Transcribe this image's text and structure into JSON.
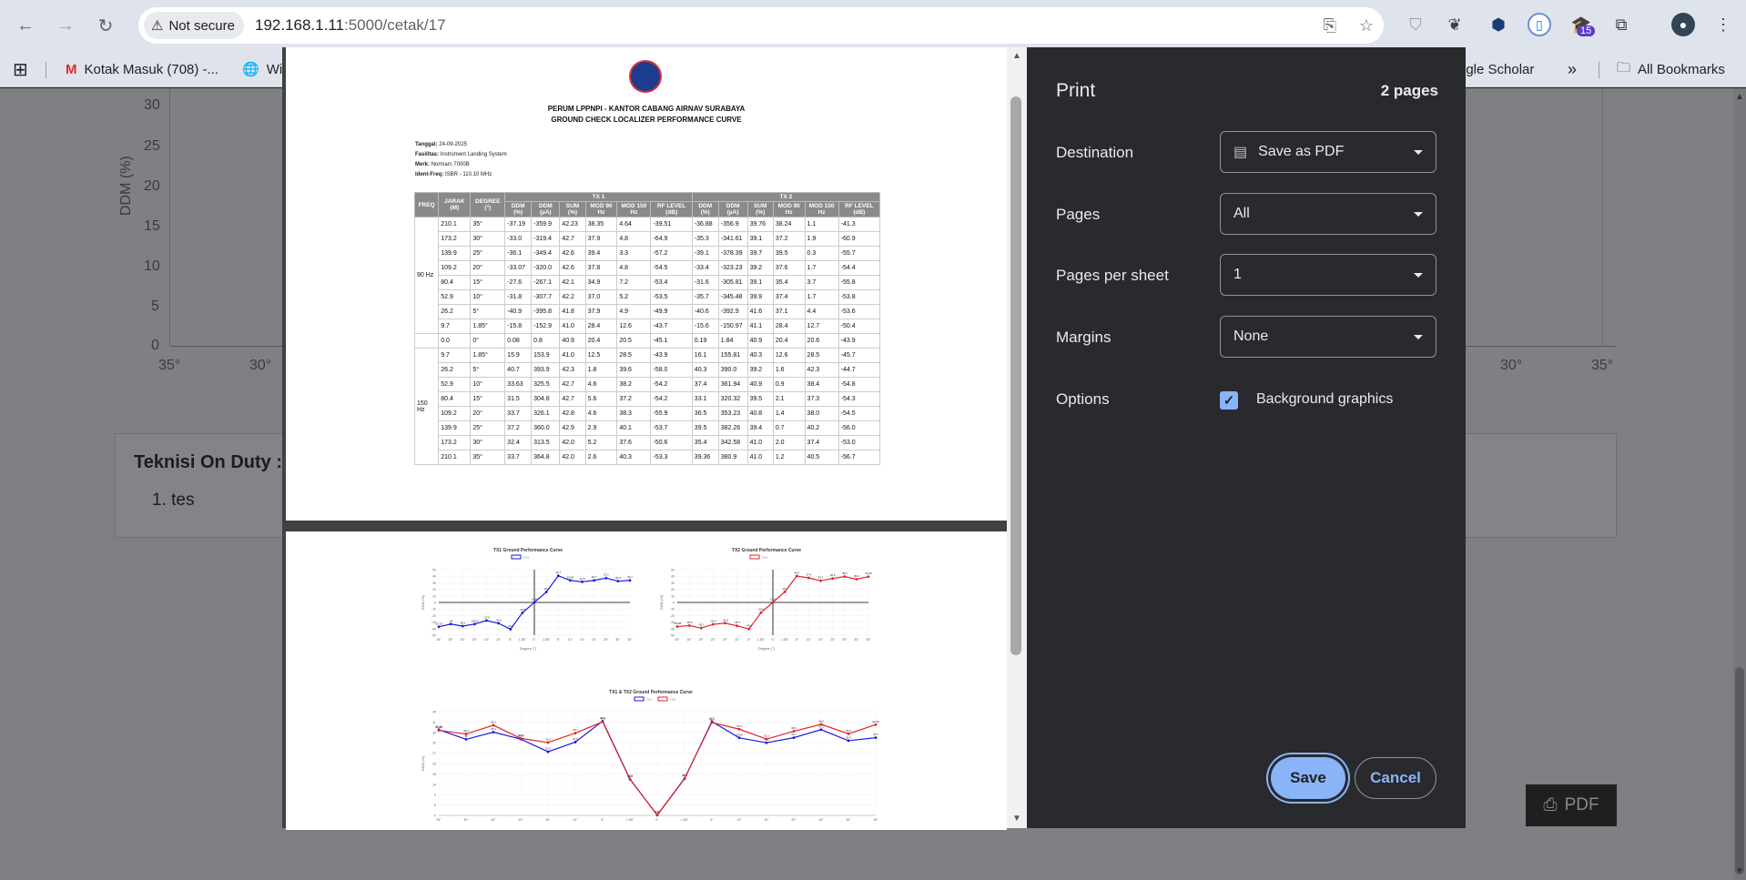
{
  "browser": {
    "security_label": "Not secure",
    "url_host": "192.168.1.11",
    "url_path": ":5000/cetak/17",
    "extension_badge": "15"
  },
  "bookmarks": {
    "items": [
      "Kotak Masuk (708) -...",
      "Wi",
      "ogle Scholar"
    ],
    "all_bookmarks": "All Bookmarks"
  },
  "background_page": {
    "y_axis_label": "DDM (%)",
    "y_ticks": [
      "30",
      "25",
      "20",
      "15",
      "10",
      "5",
      "0"
    ],
    "x_ticks_left": [
      "35°",
      "30°"
    ],
    "x_ticks_right": [
      "30°",
      "35°"
    ],
    "technician_title": "Teknisi On Duty :",
    "technician_item": "1. tes",
    "pdf_button": "PDF"
  },
  "print_preview": {
    "header_line1": "PERUM LPPNPI - KANTOR CABANG AIRNAV SURABAYA",
    "header_line2": "GROUND CHECK LOCALIZER PERFORMANCE CURVE",
    "meta": [
      {
        "label": "Tanggal:",
        "value": "24-09-2025"
      },
      {
        "label": "Fasilitas:",
        "value": "Instrument Landing System"
      },
      {
        "label": "Merk:",
        "value": "Normarc 7000B"
      },
      {
        "label": "Ident-Freq:",
        "value": "ISBR - 110.10 MHz"
      }
    ],
    "table_headers": {
      "freq": "FREQ",
      "jarak": "JARAK (M)",
      "degree": "DEGREE (°)",
      "tx1": "TX 1",
      "tx2": "TX 2",
      "sub": [
        "DDM (%)",
        "DDM (µA)",
        "SUM (%)",
        "MOD 90 Hz",
        "MOD 150 Hz",
        "RF LEVEL (dB)"
      ]
    },
    "group_90": "90 Hz",
    "group_150": "150 Hz",
    "rows_90": [
      [
        "210.1",
        "35°",
        "-37.19",
        "-359.9",
        "42.23",
        "38.35",
        "4.64",
        "-39.51",
        "-36.88",
        "-356.9",
        "39.76",
        "38.24",
        "1.1",
        "-41.3"
      ],
      [
        "173.2",
        "30°",
        "-33.0",
        "-319.4",
        "42.7",
        "37.9",
        "4.8",
        "-64.9",
        "-35.3",
        "-341.61",
        "39.1",
        "37.2",
        "1.9",
        "-60.9"
      ],
      [
        "139.9",
        "25°",
        "-36.1",
        "-349.4",
        "42.6",
        "39.4",
        "3.3",
        "-57.2",
        "-39.1",
        "-378.39",
        "39.7",
        "39.5",
        "0.3",
        "-55.7"
      ],
      [
        "109.2",
        "20°",
        "-33.07",
        "-320.0",
        "42.6",
        "37.8",
        "4.8",
        "-54.5",
        "-33.4",
        "-323.23",
        "39.2",
        "37.6",
        "1.7",
        "-54.4"
      ],
      [
        "80.4",
        "15°",
        "-27.6",
        "-267.1",
        "42.1",
        "34.9",
        "7.2",
        "-53.4",
        "-31.6",
        "-305.81",
        "39.1",
        "35.4",
        "3.7",
        "-55.8"
      ],
      [
        "52.9",
        "10°",
        "-31.8",
        "-307.7",
        "42.2",
        "37.0",
        "5.2",
        "-53.5",
        "-35.7",
        "-345.48",
        "39.9",
        "37.4",
        "1.7",
        "-53.8"
      ],
      [
        "26.2",
        "5°",
        "-40.9",
        "-395.8",
        "41.8",
        "37.9",
        "4.9",
        "-49.9",
        "-40.6",
        "-392.9",
        "41.6",
        "37.1",
        "4.4",
        "-53.6"
      ],
      [
        "9.7",
        "1.85°",
        "-15.8",
        "-152.9",
        "41.0",
        "28.4",
        "12.6",
        "-43.7",
        "-15.6",
        "-150.97",
        "41.1",
        "28.4",
        "12.7",
        "-50.4"
      ]
    ],
    "row_zero": [
      "0.0",
      "0°",
      "0.08",
      "0.8",
      "40.9",
      "20.4",
      "20.5",
      "-45.1",
      "0.19",
      "1.84",
      "40.9",
      "20.4",
      "20.6",
      "-43.9"
    ],
    "rows_150": [
      [
        "9.7",
        "1.85°",
        "15.9",
        "153.9",
        "41.0",
        "12.5",
        "28.5",
        "-43.9",
        "16.1",
        "155.81",
        "40.3",
        "12.6",
        "28.5",
        "-45.7"
      ],
      [
        "26.2",
        "5°",
        "40.7",
        "393.9",
        "42.3",
        "1.8",
        "39.6",
        "-58.0",
        "40.3",
        "390.0",
        "39.2",
        "1.6",
        "42.3",
        "-44.7"
      ],
      [
        "52.9",
        "10°",
        "33.63",
        "325.5",
        "42.7",
        "4.6",
        "38.2",
        "-54.2",
        "37.4",
        "361.94",
        "40.9",
        "0.9",
        "38.4",
        "-54.8"
      ],
      [
        "80.4",
        "15°",
        "31.5",
        "304.8",
        "42.7",
        "5.6",
        "37.2",
        "-54.2",
        "33.1",
        "320.32",
        "39.5",
        "2.1",
        "37.3",
        "-54.3"
      ],
      [
        "109.2",
        "20°",
        "33.7",
        "326.1",
        "42.8",
        "4.6",
        "38.3",
        "-55.9",
        "36.5",
        "353.23",
        "40.8",
        "1.4",
        "38.0",
        "-54.5"
      ],
      [
        "139.9",
        "25°",
        "37.2",
        "360.0",
        "42.9",
        "2.9",
        "40.1",
        "-53.7",
        "39.5",
        "382.26",
        "39.4",
        "0.7",
        "40.2",
        "-56.0"
      ],
      [
        "173.2",
        "30°",
        "32.4",
        "313.5",
        "42.0",
        "5.2",
        "37.6",
        "-50.6",
        "35.4",
        "342.58",
        "41.0",
        "2.0",
        "37.4",
        "-53.0"
      ],
      [
        "210.1",
        "35°",
        "33.7",
        "364.8",
        "42.0",
        "2.6",
        "40.3",
        "-53.3",
        "39.36",
        "380.9",
        "41.0",
        "1.2",
        "40.5",
        "-56.7"
      ]
    ],
    "chart_tx1_title": "TX1  Ground Performance Curve",
    "chart_tx2_title": "TX2  Ground Performance Curve",
    "chart_combined_title": "TX1 & TX2 Ground Performance Curve",
    "legend_tx1": "TX1",
    "legend_tx2": "TX2",
    "x_axis_label": "Degree (°)",
    "y_axis_label": "DDM (%)"
  },
  "chart_data": [
    {
      "type": "line",
      "title": "TX1  Ground Performance Curve",
      "xlabel": "Degree (°)",
      "ylabel": "DDM (%)",
      "categories": [
        "35°",
        "30°",
        "25°",
        "20°",
        "15°",
        "10°",
        "5°",
        "1.85°",
        "0°",
        "1.85°",
        "5°",
        "10°",
        "15°",
        "20°",
        "25°",
        "30°",
        "35°"
      ],
      "series": [
        {
          "name": "TX1",
          "color": "#1a1adf",
          "values": [
            -37.19,
            -33.0,
            -36.1,
            -33.07,
            -27.6,
            -31.8,
            -40.9,
            -15.8,
            0.08,
            15.9,
            40.7,
            33.63,
            31.5,
            33.7,
            37.2,
            32.4,
            33.7
          ]
        }
      ],
      "ylim": [
        -50,
        50
      ]
    },
    {
      "type": "line",
      "title": "TX2  Ground Performance Curve",
      "xlabel": "Degree (°)",
      "ylabel": "DDM (%)",
      "categories": [
        "35°",
        "30°",
        "25°",
        "20°",
        "15°",
        "10°",
        "5°",
        "1.85°",
        "0°",
        "1.85°",
        "5°",
        "10°",
        "15°",
        "20°",
        "25°",
        "30°",
        "35°"
      ],
      "series": [
        {
          "name": "TX2",
          "color": "#e02424",
          "values": [
            -36.88,
            -35.3,
            -39.1,
            -33.4,
            -31.6,
            -35.7,
            -40.6,
            -15.6,
            0.19,
            16.1,
            40.3,
            37.4,
            33.1,
            36.5,
            39.5,
            35.4,
            39.36
          ]
        }
      ],
      "ylim": [
        -50,
        50
      ]
    },
    {
      "type": "line",
      "title": "TX1 & TX2 Ground Performance Curve",
      "xlabel": "",
      "ylabel": "DDM (%)",
      "categories": [
        "35°",
        "30°",
        "25°",
        "20°",
        "15°",
        "10°",
        "5°",
        "1.85°",
        "0°",
        "1.85°",
        "5°",
        "10°",
        "15°",
        "20°",
        "25°",
        "30°",
        "35°"
      ],
      "series": [
        {
          "name": "TX1",
          "color": "#1a1adf",
          "values": [
            37.19,
            33.0,
            36.1,
            33.07,
            27.6,
            31.8,
            40.9,
            15.8,
            0.08,
            15.9,
            40.7,
            33.63,
            31.5,
            33.7,
            37.2,
            32.4,
            33.7
          ]
        },
        {
          "name": "TX2",
          "color": "#e02424",
          "values": [
            36.88,
            35.3,
            39.1,
            33.4,
            31.6,
            35.7,
            40.6,
            15.6,
            0.19,
            16.1,
            40.3,
            37.4,
            33.1,
            36.5,
            39.5,
            35.4,
            39.36
          ]
        }
      ],
      "ylim": [
        0,
        45
      ]
    }
  ],
  "print_dialog": {
    "title": "Print",
    "page_count": "2 pages",
    "destination_label": "Destination",
    "destination_value": "Save as PDF",
    "pages_label": "Pages",
    "pages_value": "All",
    "pps_label": "Pages per sheet",
    "pps_value": "1",
    "margins_label": "Margins",
    "margins_value": "None",
    "options_label": "Options",
    "bg_graphics_label": "Background graphics",
    "save": "Save",
    "cancel": "Cancel"
  }
}
